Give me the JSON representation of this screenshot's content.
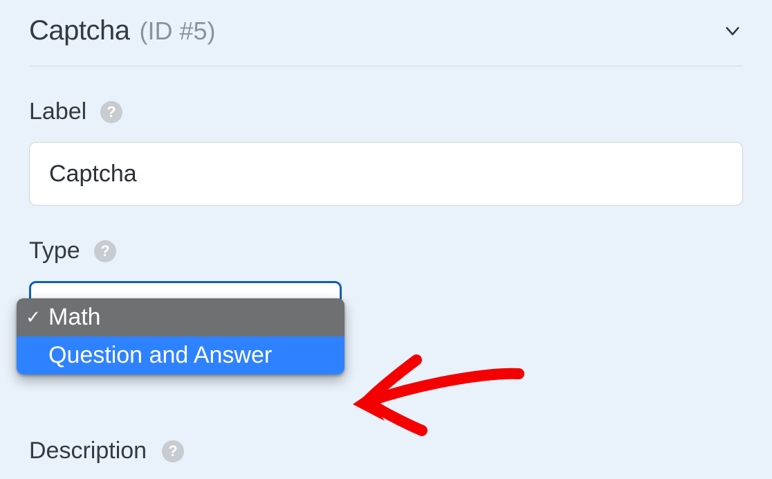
{
  "header": {
    "title": "Captcha",
    "idtag": "(ID #5)"
  },
  "fields": {
    "label": {
      "label": "Label",
      "value": "Captcha"
    },
    "type": {
      "label": "Type",
      "options": [
        {
          "label": "Math",
          "selected": true,
          "highlighted": false
        },
        {
          "label": "Question and Answer",
          "selected": false,
          "highlighted": true
        }
      ]
    },
    "description": {
      "label": "Description"
    }
  }
}
